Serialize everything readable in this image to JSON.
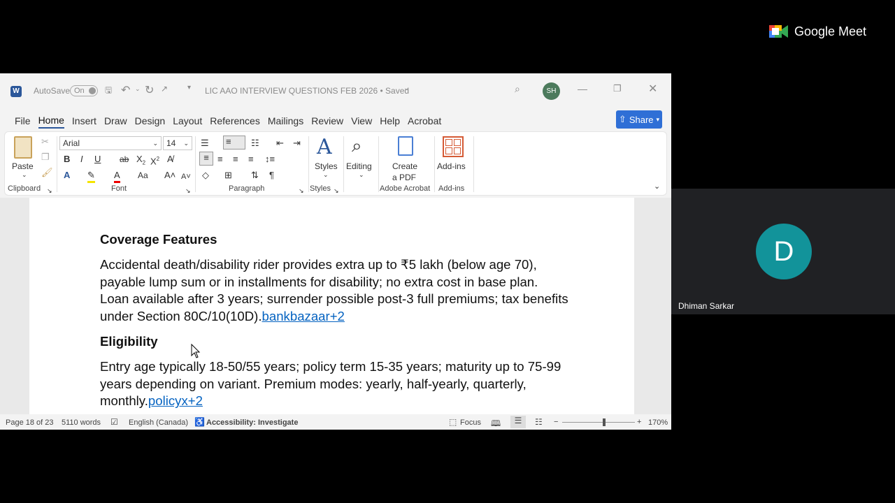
{
  "meet": {
    "brand": "Google Meet",
    "participant": {
      "initial": "D",
      "name": "Dhiman Sarkar",
      "avatar_color": "#12939a"
    }
  },
  "titlebar": {
    "autosave_label": "AutoSave",
    "autosave_state": "On",
    "doc_title": "LIC AAO INTERVIEW QUESTIONS FEB 2026 • Saved",
    "user_initials": "SH"
  },
  "tabs": [
    "File",
    "Home",
    "Insert",
    "Draw",
    "Design",
    "Layout",
    "References",
    "Mailings",
    "Review",
    "View",
    "Help",
    "Acrobat"
  ],
  "active_tab": "Home",
  "share_label": "Share",
  "ribbon": {
    "paste_label": "Paste",
    "font_name": "Arial",
    "font_size": "14",
    "styles_label": "Styles",
    "editing_label": "Editing",
    "create_pdf_line1": "Create",
    "create_pdf_line2": "a PDF",
    "addins_label": "Add-ins",
    "groups": {
      "clipboard": "Clipboard",
      "font": "Font",
      "paragraph": "Paragraph",
      "styles": "Styles",
      "adobe": "Adobe Acrobat",
      "addins": "Add-ins"
    }
  },
  "document": {
    "heading1": "Coverage Features",
    "para1": "Accidental death/disability rider provides extra up to ₹5 lakh (below age 70), payable lump sum or in installments for disability; no extra cost in base plan. Loan available after 3 years; surrender possible post-3 full premiums; tax benefits under Section 80C/10(10D).",
    "link1": "bankbazaar+2",
    "heading2": "Eligibility",
    "para2": "Entry age typically 18-50/55 years; policy term 15-35 years; maturity up to 75-99 years depending on variant. Premium modes: yearly, half-yearly, quarterly, monthly.",
    "link2": "policyx+2"
  },
  "statusbar": {
    "page": "Page 18 of 23",
    "words": "5110 words",
    "language": "English (Canada)",
    "accessibility": "Accessibility: Investigate",
    "focus": "Focus",
    "zoom": "170%"
  }
}
